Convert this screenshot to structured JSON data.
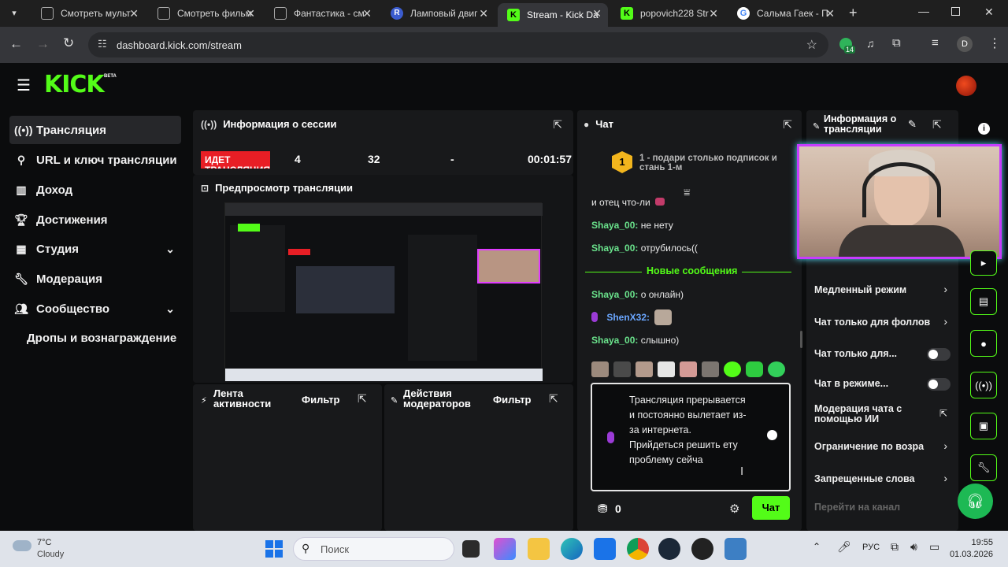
{
  "browser": {
    "tabs": [
      {
        "title": "Смотреть мульт",
        "color": "#2f6ee0"
      },
      {
        "title": "Смотреть фильм",
        "color": "#2f6ee0"
      },
      {
        "title": "Фантастика - см",
        "color": "#2f6ee0"
      },
      {
        "title": "Ламповый двиг",
        "color": "#3b5ccf",
        "letter": "R"
      },
      {
        "title": "Stream - Kick Da",
        "color": "#53fc18",
        "letter": "K"
      },
      {
        "title": "popovich228 Str",
        "color": "#53fc18",
        "letter": "K"
      },
      {
        "title": "Сальма Гаек - П",
        "color": "#ffffff",
        "letter": "G"
      }
    ],
    "url": "dashboard.kick.com/stream",
    "profile_letter": "D",
    "ext_badge": "14"
  },
  "app": {
    "logo": "KICK",
    "logo_beta": "BETA",
    "nav": [
      {
        "label": "Трансляция",
        "icon": "broadcast-icon"
      },
      {
        "label": "URL и ключ трансляции",
        "icon": "link-icon"
      },
      {
        "label": "Доход",
        "icon": "chart-icon"
      },
      {
        "label": "Достижения",
        "icon": "trophy-icon"
      },
      {
        "label": "Студия",
        "icon": "studio-icon"
      },
      {
        "label": "Модерация",
        "icon": "wrench-icon"
      },
      {
        "label": "Сообщество",
        "icon": "community-icon"
      },
      {
        "label": "Дропы и вознаграждение",
        "icon": ""
      }
    ]
  },
  "session": {
    "title": "Информация о сессии",
    "live_label": "ИДЕТ ТРАНСЛЯЦИЯ",
    "viewers": "4",
    "followers": "32",
    "subs": "-",
    "uptime": "00:01:57"
  },
  "preview": {
    "title": "Предпросмотр трансляции"
  },
  "activity": {
    "title": "Лента активности",
    "filter": "Фильтр"
  },
  "modactions": {
    "title": "Действия модераторов",
    "filter": "Фильтр"
  },
  "chat": {
    "title": "Чат",
    "promo": "1 - подари столько подписок и стань 1-м",
    "promo_rank": "1",
    "messages": [
      {
        "user": "",
        "text": "и отец что-ли"
      },
      {
        "user": "Shaya_00:",
        "text": "не нету"
      },
      {
        "user": "Shaya_00:",
        "text": "отрубилось(("
      },
      {
        "user": "Shaya_00:",
        "text": "о онлайн)"
      },
      {
        "user": "ShenX32:",
        "text": ""
      },
      {
        "user": "Shaya_00:",
        "text": "слышно)"
      }
    ],
    "new_divider": "Новые сообщения",
    "input_text": "Трансляция прерывается и постоянно вылетает из-за интернета. Прийдеться решить ету проблему сейча",
    "points": "0",
    "send_label": "Чат"
  },
  "stream_info": {
    "title": "Информация о трансляции",
    "settings": [
      {
        "label": "Медленный режим",
        "kind": "chevron"
      },
      {
        "label": "Чат только для фоллов",
        "kind": "chevron"
      },
      {
        "label": "Чат только для...",
        "kind": "toggle"
      },
      {
        "label": "Чат в режиме...",
        "kind": "toggle"
      },
      {
        "label": "Модерация чата с помощью ИИ",
        "kind": "external"
      },
      {
        "label": "Ограничение по возра",
        "kind": "chevron"
      },
      {
        "label": "Запрещенные слова",
        "kind": "chevron"
      },
      {
        "label": "Перейти на канал",
        "kind": "link"
      }
    ]
  },
  "taskbar": {
    "weather_temp": "7°C",
    "weather_desc": "Cloudy",
    "search_placeholder": "Поиск",
    "lang": "РУС",
    "time": "19:55",
    "date": "01.03.2026"
  },
  "colors": {
    "accent": "#53fc18",
    "live": "#e81e25",
    "panel": "#18191b",
    "bg": "#0b0c0d"
  }
}
